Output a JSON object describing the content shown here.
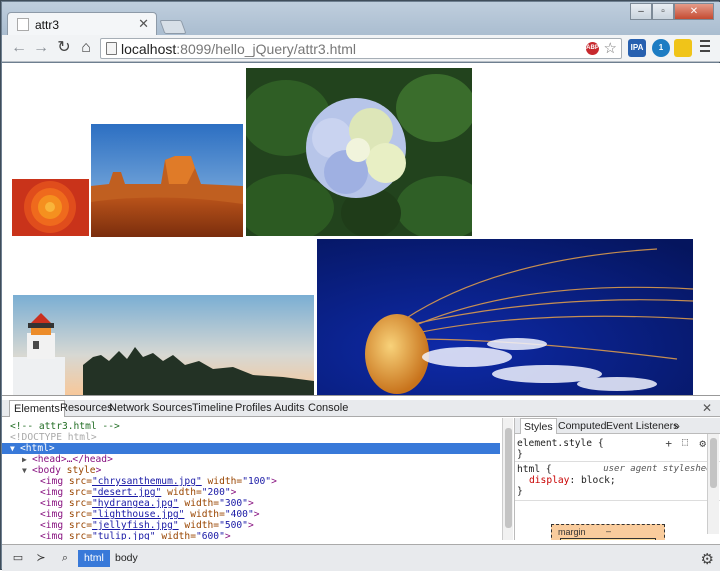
{
  "window": {
    "tab_title": "attr3",
    "tab_close": "✕",
    "min": "–",
    "max": "▫",
    "close": "✕"
  },
  "toolbar": {
    "back_icon": "←",
    "forward_icon": "→",
    "reload_icon": "↻",
    "home_icon": "⌂",
    "url_host": "localhost",
    "url_rest": ":8099/hello_jQuery/attr3.html",
    "star_icon": "☆",
    "abp_label": "ABP",
    "ext1_label": "IPA",
    "ext2_label": "1"
  },
  "page": {
    "images": [
      {
        "name": "chrysanthemum",
        "colors": [
          "#c9331a",
          "#f5901f"
        ]
      },
      {
        "name": "desert",
        "colors": [
          "#2c6fc2",
          "#e07b28"
        ]
      },
      {
        "name": "hydrangea",
        "colors": [
          "#22431d",
          "#b7c5e9"
        ]
      },
      {
        "name": "jellyfish",
        "colors": [
          "#05155e",
          "#e2b04d"
        ]
      },
      {
        "name": "lighthouse",
        "colors": [
          "#7aaed3",
          "#f7c89a"
        ]
      }
    ]
  },
  "devtools": {
    "tabs": [
      "Elements",
      "Resources",
      "Network",
      "Sources",
      "Timeline",
      "Profiles",
      "Audits",
      "Console"
    ],
    "close": "✕",
    "dom": {
      "comment": "<!-- attr3.html -->",
      "doctype": "<!DOCTYPE html>",
      "html_open": "<html>",
      "head": "<head>…</head>",
      "body_tag": "<body",
      "body_attr": "style",
      "img_tag": "<img",
      "src_attr": "src=",
      "width_attr": "width=",
      "img_close": ">",
      "images": [
        {
          "src": "\"chrysanthemum.jpg\"",
          "width": "\"100\""
        },
        {
          "src": "\"desert.jpg\"",
          "width": "\"200\""
        },
        {
          "src": "\"hydrangea.jpg\"",
          "width": "\"300\""
        },
        {
          "src": "\"lighthouse.jpg\"",
          "width": "\"400\""
        },
        {
          "src": "\"jellyfish.jpg\"",
          "width": "\"500\""
        },
        {
          "src": "\"tulip.jpg\"",
          "width": "\"600\""
        }
      ]
    },
    "styles": {
      "tabs": [
        "Styles",
        "Computed",
        "Event Listeners"
      ],
      "more": "»",
      "rule1_selector": "element.style {",
      "rule1_close": "}",
      "rule2_selector": "html {",
      "rule2_source": "user agent stylesheet",
      "rule2_prop": "display",
      "rule2_value": ": block;",
      "rule2_close": "}",
      "box_label": "margin",
      "box_dash": "–"
    },
    "bottom": {
      "crumbs": [
        "html",
        "body"
      ]
    }
  }
}
